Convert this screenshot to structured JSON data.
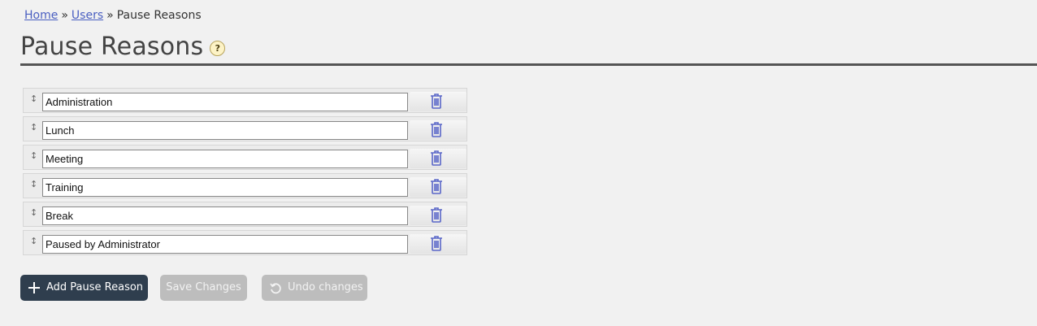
{
  "breadcrumb": {
    "home": "Home",
    "sep1": "»",
    "users": "Users",
    "sep2": "»",
    "current": "Pause Reasons"
  },
  "page": {
    "title": "Pause Reasons",
    "help_icon": "question-mark-icon",
    "help_glyph": "?"
  },
  "reasons": [
    {
      "value": "Administration"
    },
    {
      "value": "Lunch"
    },
    {
      "value": "Meeting"
    },
    {
      "value": "Training"
    },
    {
      "value": "Break"
    },
    {
      "value": "Paused by Administrator"
    }
  ],
  "icons": {
    "drag": "drag-handle-icon",
    "delete": "trash-icon",
    "handle_glyph": "↕"
  },
  "buttons": {
    "add": "Add Pause Reason",
    "save": "Save Changes",
    "undo": "Undo changes"
  },
  "colors": {
    "link": "#4a5fc1",
    "primary_button": "#2f3e4e",
    "disabled_button": "#bdbdbd",
    "trash": "#5a67c8"
  }
}
